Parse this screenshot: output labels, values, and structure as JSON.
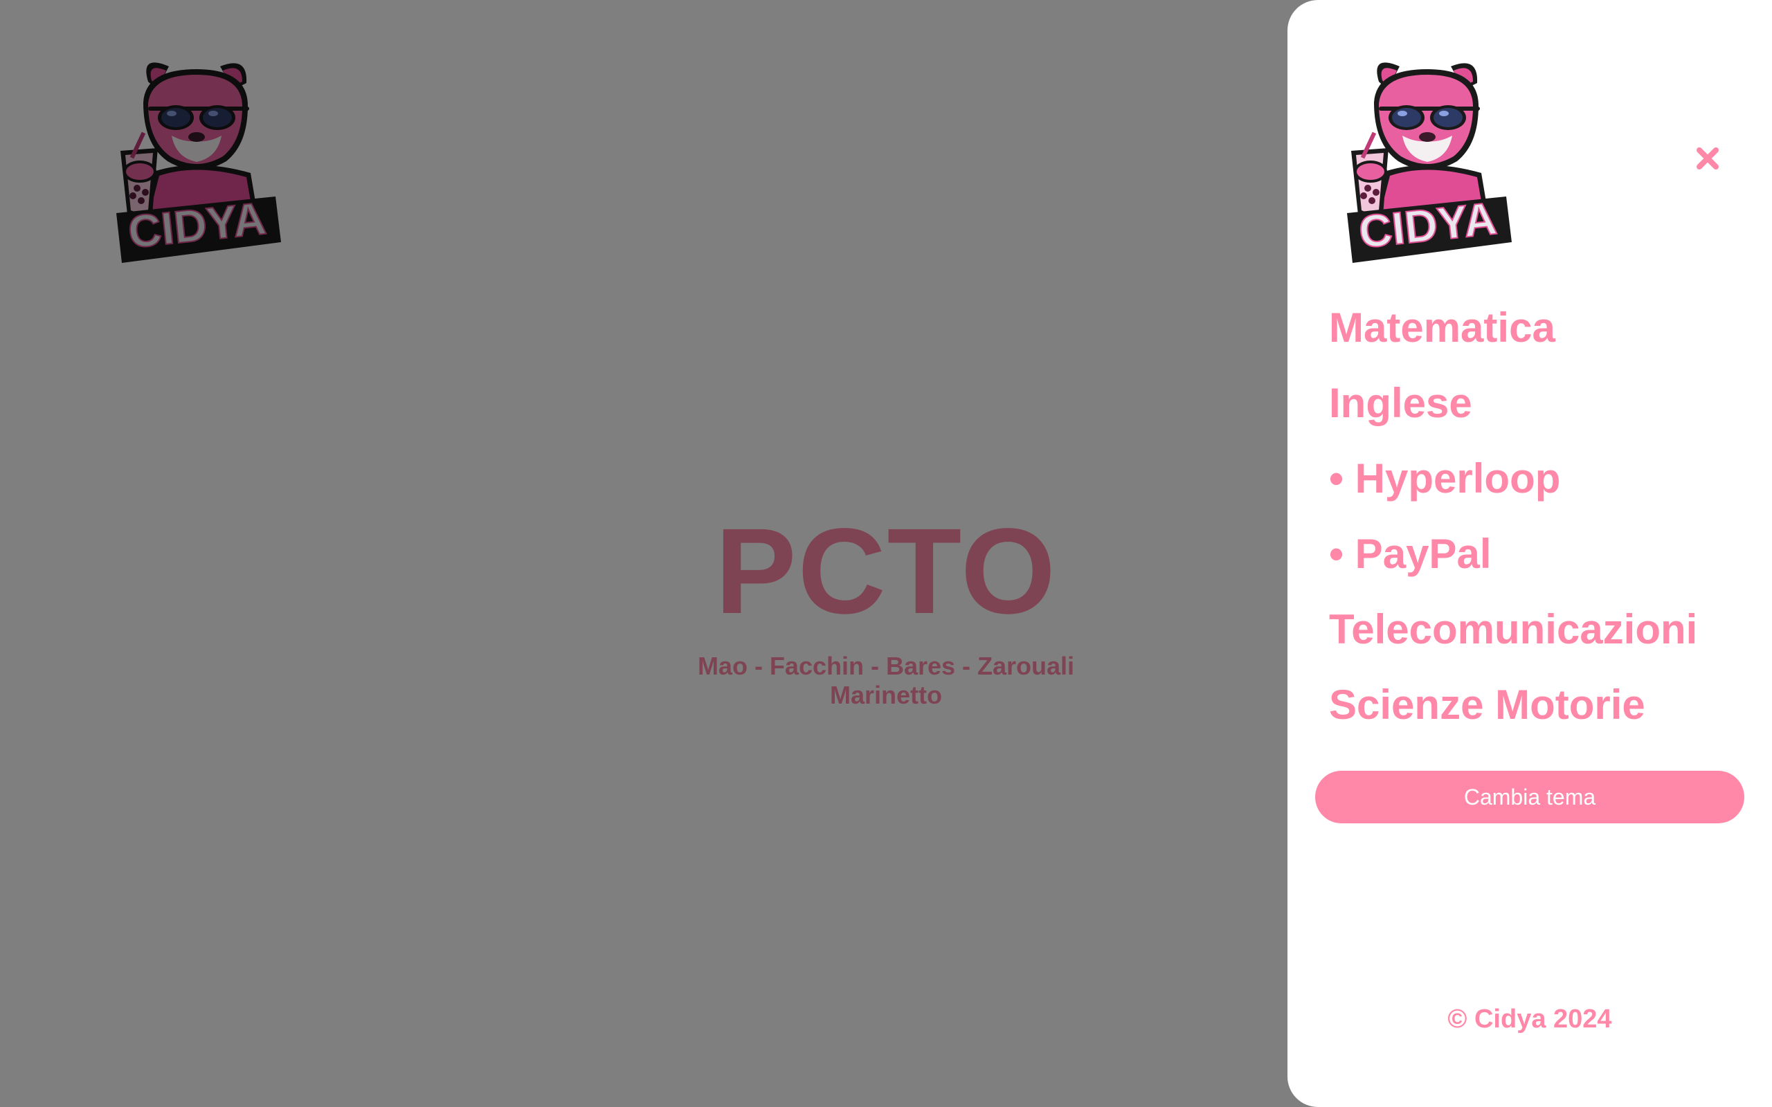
{
  "colors": {
    "accent": "#ff88a8",
    "overlay": "rgba(0,0,0,0.5)",
    "background": "#ffffff"
  },
  "brand": {
    "logo_text": "CIDYA",
    "logo_icon": "panther-mascot-logo"
  },
  "hero": {
    "title": "PCTO",
    "authors_line1": "Mao - Facchin - Bares - Zarouali",
    "authors_line2": "Marinetto"
  },
  "menu": {
    "close_icon": "close-icon",
    "items": [
      {
        "label": "Matematica"
      },
      {
        "label": "Inglese"
      },
      {
        "label": "• Hyperloop"
      },
      {
        "label": "• PayPal"
      },
      {
        "label": "Telecomunicazioni"
      },
      {
        "label": "Scienze Motorie"
      }
    ],
    "theme_button": "Cambia tema",
    "copyright": "© Cidya 2024"
  }
}
